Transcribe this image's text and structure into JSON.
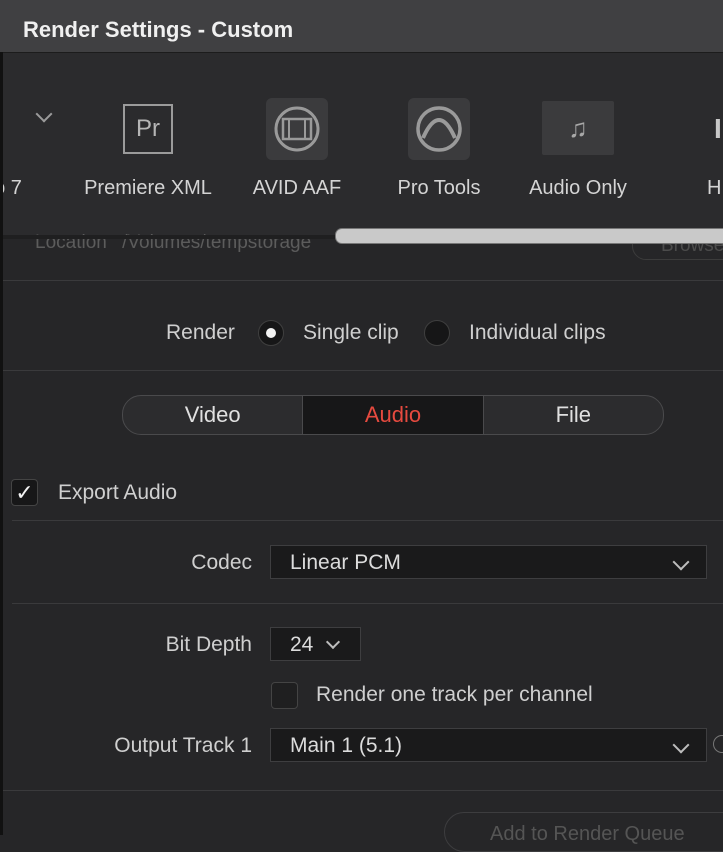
{
  "window": {
    "title": "Render Settings - Custom"
  },
  "presets": [
    {
      "label": "o 7",
      "icon": "chevron-down-icon"
    },
    {
      "label": "Premiere XML",
      "icon": "premiere-pr-icon",
      "icon_text": "Pr"
    },
    {
      "label": "AVID AAF",
      "icon": "avid-film-reel-icon"
    },
    {
      "label": "Pro Tools",
      "icon": "pro-tools-icon"
    },
    {
      "label": "Audio Only",
      "icon": "music-note-icon",
      "icon_text": "♫"
    },
    {
      "label": "HD",
      "icon": "imf-icon",
      "icon_text": "IM"
    }
  ],
  "location": {
    "label": "Location",
    "value": "/Volumes/tempstorage",
    "browse": "Browse"
  },
  "render": {
    "label": "Render",
    "options": [
      {
        "label": "Single clip",
        "selected": true
      },
      {
        "label": "Individual clips",
        "selected": false
      }
    ]
  },
  "tabs": [
    {
      "label": "Video",
      "active": false
    },
    {
      "label": "Audio",
      "active": true
    },
    {
      "label": "File",
      "active": false
    }
  ],
  "audio": {
    "export_audio": {
      "label": "Export Audio",
      "checked": true,
      "check_glyph": "✓"
    },
    "codec": {
      "label": "Codec",
      "value": "Linear PCM"
    },
    "bit_depth": {
      "label": "Bit Depth",
      "value": "24"
    },
    "one_track_per_channel": {
      "label": "Render one track per channel",
      "checked": false
    },
    "output_track_1": {
      "label": "Output Track 1",
      "value": "Main 1 (5.1)"
    }
  },
  "footer": {
    "add_to_queue": "Add to Render Queue"
  },
  "colors": {
    "accent_active_tab": "#e64a3f"
  }
}
